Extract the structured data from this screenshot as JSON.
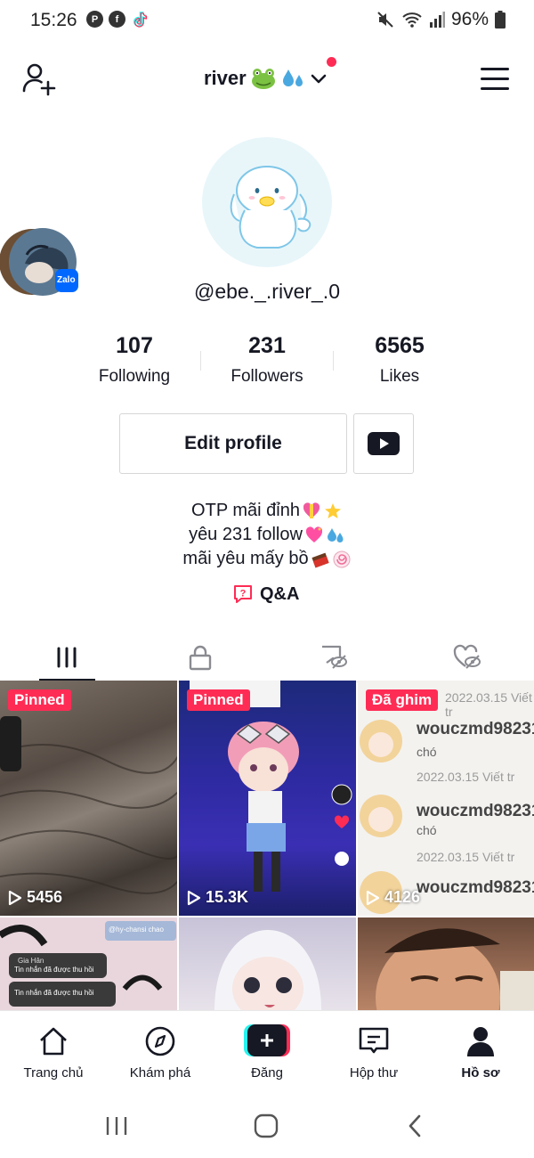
{
  "status_bar": {
    "time": "15:26",
    "battery": "96%",
    "app_icons": [
      "pinterest-icon",
      "facebook-icon",
      "tiktok-icon"
    ],
    "right_icons": [
      "mute-icon",
      "wifi-icon",
      "signal-icon",
      "battery-icon"
    ]
  },
  "header": {
    "account_name": "river",
    "account_emoji": [
      "frog-emoji",
      "sweat-droplets-emoji"
    ],
    "has_notification_dot": true
  },
  "profile": {
    "username": "@ebe._.river_.0",
    "side_avatar_badge": "Zalo"
  },
  "stats": [
    {
      "value": "107",
      "label": "Following"
    },
    {
      "value": "231",
      "label": "Followers"
    },
    {
      "value": "6565",
      "label": "Likes"
    }
  ],
  "actions": {
    "edit_profile": "Edit profile"
  },
  "bio": {
    "lines": [
      {
        "text": "OTP mãi đỉnh",
        "emoji": [
          "heart-with-ribbon",
          "dizzy"
        ]
      },
      {
        "text": "yêu 231 follow",
        "emoji": [
          "sparkling-heart",
          "sweat-droplets"
        ]
      },
      {
        "text": "mãi yêu mấy bồ",
        "emoji": [
          "chocolate",
          "fish-cake"
        ]
      }
    ]
  },
  "qa_label": "Q&A",
  "tabs": [
    {
      "icon": "grid-icon",
      "active": true
    },
    {
      "icon": "lock-icon",
      "active": false
    },
    {
      "icon": "hidden-tag-icon",
      "active": false
    },
    {
      "icon": "hidden-heart-icon",
      "active": false
    }
  ],
  "videos": [
    {
      "badge": "Pinned",
      "views": "5456"
    },
    {
      "badge": "Pinned",
      "views": "15.3K"
    },
    {
      "badge": "Đã ghim",
      "views": "4126",
      "overlay_text": [
        "2022.03.15 Viết tr",
        "wouczmd98231",
        "chó",
        "2022.03.15 Viết tr",
        "wouczmd98231",
        "chó",
        "2022.03.15 Viết tr",
        "wouczmd98231"
      ]
    },
    {
      "overlay_text": [
        "Gia Hân",
        "Tin nhắn đã được thu hồi",
        "Tin nhắn đã được thu hồi",
        "@hy-chansi chao"
      ]
    },
    {},
    {}
  ],
  "bottom_nav": [
    {
      "label": "Trang chủ",
      "icon": "home-icon"
    },
    {
      "label": "Khám phá",
      "icon": "compass-icon"
    },
    {
      "label": "Đăng",
      "icon": "plus-icon"
    },
    {
      "label": "Hộp thư",
      "icon": "inbox-icon"
    },
    {
      "label": "Hồ sơ",
      "icon": "profile-icon",
      "active": true
    }
  ],
  "colors": {
    "accent": "#fe2c55",
    "text": "#161823",
    "cyan": "#25f4ee"
  }
}
